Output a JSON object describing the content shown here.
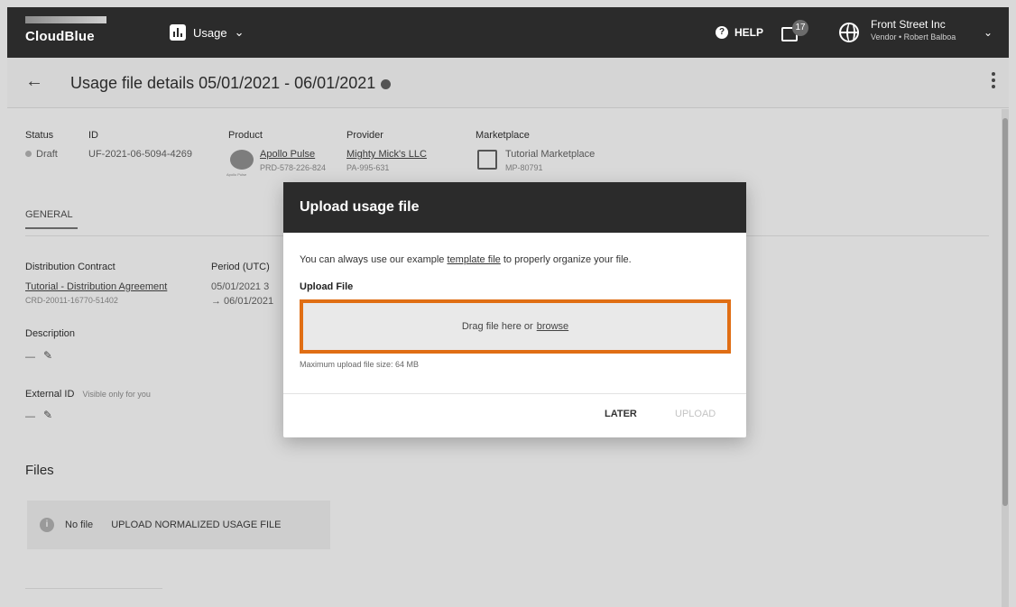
{
  "app": {
    "logo": "CloudBlue",
    "module": "Usage",
    "help": "HELP",
    "notification_count": "17",
    "account_name": "Front Street Inc",
    "account_role": "Vendor • Robert Balboa"
  },
  "page": {
    "title": "Usage file details 05/01/2021 - 06/01/2021"
  },
  "summary": {
    "status_label": "Status",
    "status_value": "Draft",
    "id_label": "ID",
    "id_value": "UF-2021-06-5094-4269",
    "product_label": "Product",
    "product_name": "Apollo Pulse",
    "product_id": "PRD-578-226-824",
    "product_logo_text": "Apollo Pulse",
    "provider_label": "Provider",
    "provider_name": "Mighty Mick's LLC",
    "provider_id": "PA-995-631",
    "marketplace_label": "Marketplace",
    "marketplace_name": "Tutorial Marketplace",
    "marketplace_id": "MP-80791"
  },
  "tabs": [
    "GENERAL"
  ],
  "general": {
    "contract_label": "Distribution Contract",
    "contract_name": "Tutorial - Distribution Agreement",
    "contract_id": "CRD-20011-16770-51402",
    "period_label": "Period (UTC)",
    "period_start": "05/01/2021 3",
    "period_end": "→ 06/01/2021",
    "description_label": "Description",
    "description_value": "—",
    "external_id_label": "External ID",
    "external_id_note": "Visible only for you",
    "external_id_value": "—"
  },
  "files": {
    "heading": "Files",
    "empty_text": "No file",
    "upload_button": "UPLOAD NORMALIZED USAGE FILE"
  },
  "modal": {
    "title": "Upload usage file",
    "text_before": "You can always use our example ",
    "template_link": "template file",
    "text_after": " to properly organize your file.",
    "upload_label": "Upload File",
    "drop_text": "Drag file here or",
    "browse": "browse",
    "max_size": "Maximum upload file size: 64 MB",
    "later": "LATER",
    "upload": "UPLOAD"
  },
  "colors": {
    "highlight": "#e06e14",
    "topbar": "#2b2b2b"
  }
}
